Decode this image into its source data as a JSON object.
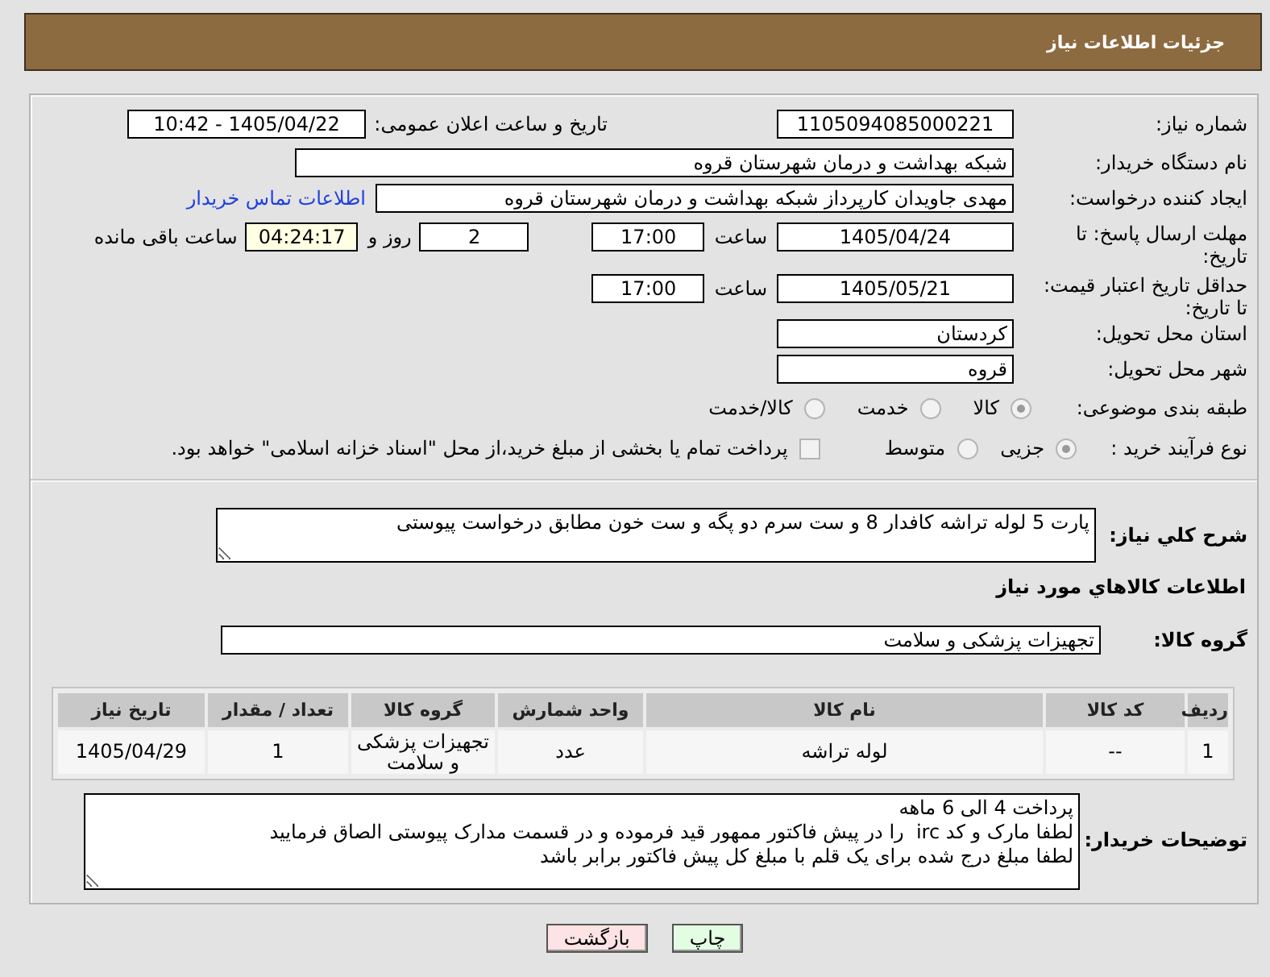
{
  "header": {
    "title": "جزئیات اطلاعات نیاز"
  },
  "need_number": {
    "label": "شماره نیاز:",
    "value": "1105094085000221"
  },
  "announcement": {
    "label": "تاریخ و ساعت اعلان عمومی:",
    "value": "1405/04/22 - 10:42"
  },
  "buyer_org": {
    "label": "نام دستگاه خریدار:",
    "value": "شبکه بهداشت و درمان شهرستان قروه"
  },
  "requester": {
    "label": "ایجاد کننده درخواست:",
    "value": "مهدی جاویدان کارپرداز شبکه بهداشت و درمان شهرستان قروه",
    "contact_link": "اطلاعات تماس خریدار"
  },
  "response_deadline": {
    "label": "مهلت ارسال پاسخ: تا تاریخ:",
    "date": "1405/04/24",
    "time_label": "ساعت",
    "time": "17:00",
    "days": "2",
    "days_label": "روز و",
    "remaining": "04:24:17",
    "remaining_label": "ساعت باقی مانده"
  },
  "price_validity": {
    "label": "حداقل تاریخ اعتبار قیمت: تا تاریخ:",
    "date": "1405/05/21",
    "time_label": "ساعت",
    "time": "17:00"
  },
  "delivery_province": {
    "label": "استان محل تحویل:",
    "value": "کردستان"
  },
  "delivery_city": {
    "label": "شهر محل تحویل:",
    "value": "قروه"
  },
  "subject_category": {
    "label": "طبقه بندی موضوعی:",
    "options": [
      {
        "label": "کالا",
        "selected": true,
        "disabled": true
      },
      {
        "label": "خدمت",
        "selected": false,
        "disabled": true
      },
      {
        "label": "کالا/خدمت",
        "selected": false,
        "disabled": true
      }
    ]
  },
  "purchase_process": {
    "label": "نوع فرآیند خرید :",
    "options": [
      {
        "label": "جزیی",
        "selected": true,
        "disabled": true
      },
      {
        "label": "متوسط",
        "selected": false,
        "disabled": true
      }
    ],
    "treasury_option": {
      "label": "پرداخت تمام یا بخشی از مبلغ خرید،از محل \"اسناد خزانه اسلامی\" خواهد بود.",
      "checked": false,
      "disabled": true
    }
  },
  "description": {
    "label": "شرح کلي نیاز:",
    "value": "پارت 5 لوله تراشه کافدار 8 و ست سرم دو پگه و ست خون مطابق درخواست پیوستی"
  },
  "goods_section": {
    "title": "اطلاعات کالاهاي مورد نیاز",
    "group_label": "گروه کالا:",
    "group_value": "تجهیزات پزشکی و سلامت"
  },
  "goods_table": {
    "columns": [
      "ردیف",
      "کد کالا",
      "نام کالا",
      "واحد شمارش",
      "گروه کالا",
      "تعداد / مقدار",
      "تاریخ نیاز"
    ],
    "rows": [
      [
        "1",
        "--",
        "لوله تراشه",
        "عدد",
        "تجهیزات پزشکی و سلامت",
        "1",
        "1405/04/29"
      ]
    ]
  },
  "buyer_notes": {
    "label": "توضیحات خریدار:",
    "lines": [
      "پرداخت 4 الی 6 ماهه",
      "لطفا مارک و کد irc  را در پیش فاکتور ممهور قید فرموده و در قسمت مدارک پیوستی الصاق فرمایید",
      "لطفا مبلغ درج شده برای یک قلم با مبلغ کل پیش فاکتور برابر باشد"
    ]
  },
  "buttons": [
    {
      "label": "چاپ",
      "kind": "print"
    },
    {
      "label": "بازگشت",
      "kind": "back"
    }
  ]
}
